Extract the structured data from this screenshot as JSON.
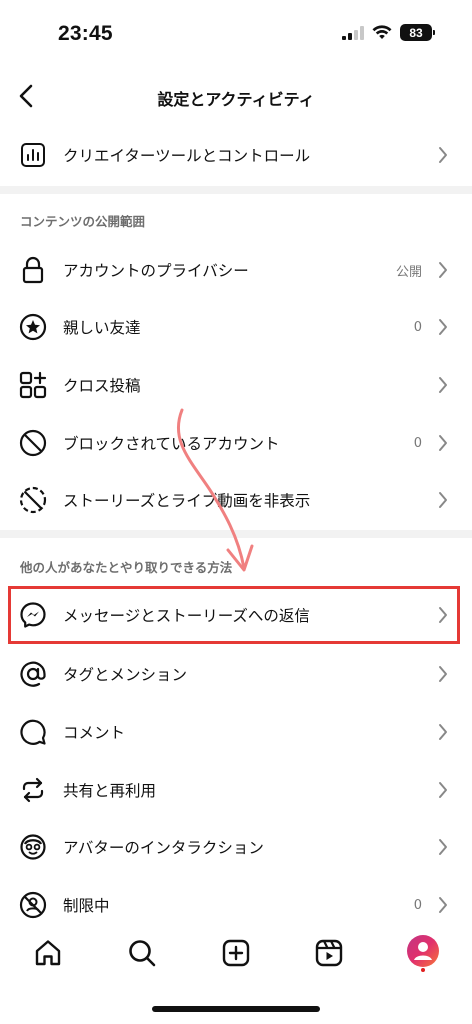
{
  "status_bar": {
    "time": "23:45",
    "battery": "83"
  },
  "header": {
    "title": "設定とアクティビティ"
  },
  "top_items": [
    {
      "label": "クリエイターツールとコントロール"
    }
  ],
  "section_content": {
    "title": "コンテンツの公開範囲",
    "items": [
      {
        "label": "アカウントのプライバシー",
        "value": "公開"
      },
      {
        "label": "親しい友達",
        "value": "0"
      },
      {
        "label": "クロス投稿",
        "value": ""
      },
      {
        "label": "ブロックされているアカウント",
        "value": "0"
      },
      {
        "label": "ストーリーズとライブ動画を非表示",
        "value": ""
      }
    ]
  },
  "section_interact": {
    "title": "他の人があなたとやり取りできる方法",
    "items": [
      {
        "label": "メッセージとストーリーズへの返信",
        "value": ""
      },
      {
        "label": "タグとメンション",
        "value": ""
      },
      {
        "label": "コメント",
        "value": ""
      },
      {
        "label": "共有と再利用",
        "value": ""
      },
      {
        "label": "アバターのインタラクション",
        "value": ""
      },
      {
        "label": "制限中",
        "value": "0"
      }
    ]
  },
  "annotation": {
    "highlight_color": "#e53935",
    "arrow_color": "#f08080"
  },
  "tab_bar": {
    "tabs": [
      "home-icon",
      "search-icon",
      "create-icon",
      "reels-icon",
      "profile-icon"
    ]
  }
}
